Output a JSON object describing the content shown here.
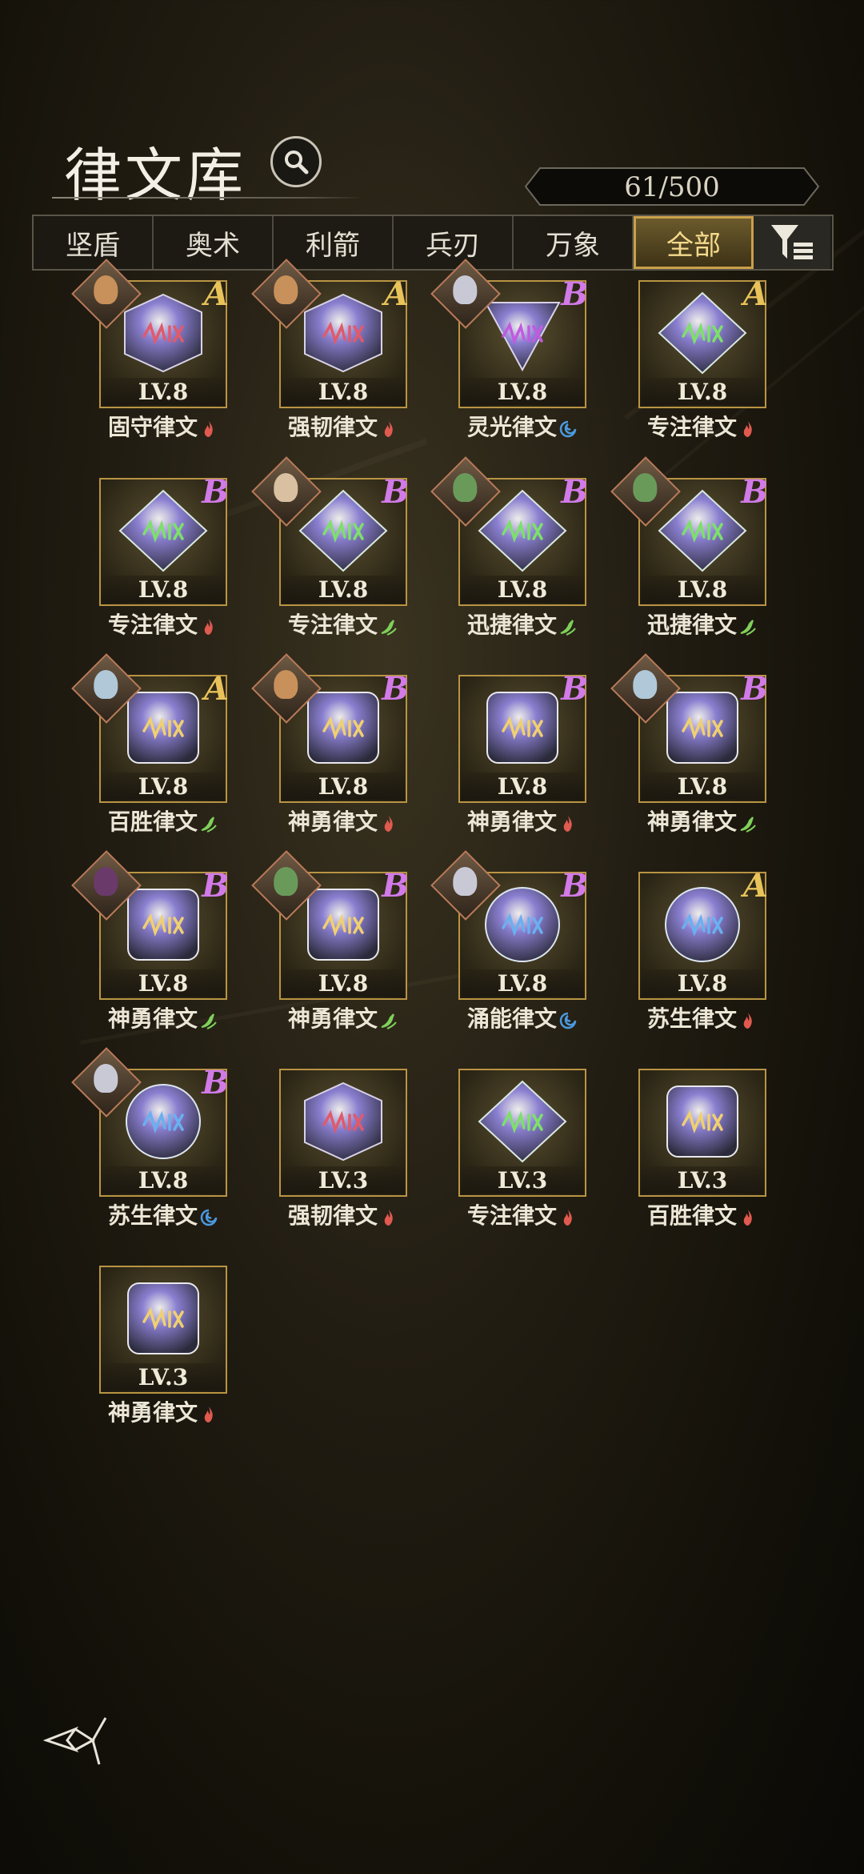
{
  "header": {
    "title": "律文库",
    "count": "61/500"
  },
  "tabs": [
    {
      "label": "坚盾",
      "active": false
    },
    {
      "label": "奥术",
      "active": false
    },
    {
      "label": "利箭",
      "active": false
    },
    {
      "label": "兵刃",
      "active": false
    },
    {
      "label": "万象",
      "active": false
    },
    {
      "label": "全部",
      "active": true
    }
  ],
  "colors": {
    "accent_gold": "#c9a04a",
    "grade_a": "#e8c35a",
    "grade_b": "#d17ae8",
    "fire": "#e05a50",
    "wind": "#7fd05a",
    "water": "#4a9ae0"
  },
  "runes": [
    {
      "name": "固守律文",
      "level": "LV.8",
      "grade": "A",
      "gem": "hex",
      "gem_color": "#8a7fd0",
      "rune_color": "#e05a6a",
      "element": "fire",
      "avatar": "#c8905a"
    },
    {
      "name": "强韧律文",
      "level": "LV.8",
      "grade": "A",
      "gem": "hex",
      "gem_color": "#8a7fd0",
      "rune_color": "#e05a6a",
      "element": "fire",
      "avatar": "#c8905a"
    },
    {
      "name": "灵光律文",
      "level": "LV.8",
      "grade": "B",
      "gem": "tri",
      "gem_color": "#9a8ad0",
      "rune_color": "#c25ae0",
      "element": "water",
      "avatar": "#c9c9d6"
    },
    {
      "name": "专注律文",
      "level": "LV.8",
      "grade": "A",
      "gem": "diamond",
      "gem_color": "#6fa08a",
      "rune_color": "#7de06a",
      "element": "fire",
      "avatar": null
    },
    {
      "name": "专注律文",
      "level": "LV.8",
      "grade": "B",
      "gem": "diamond",
      "gem_color": "#6fa08a",
      "rune_color": "#7de06a",
      "element": "fire",
      "avatar": null
    },
    {
      "name": "专注律文",
      "level": "LV.8",
      "grade": "B",
      "gem": "diamond",
      "gem_color": "#6fa08a",
      "rune_color": "#7de06a",
      "element": "wind",
      "avatar": "#d8c0a0"
    },
    {
      "name": "迅捷律文",
      "level": "LV.8",
      "grade": "B",
      "gem": "diamond",
      "gem_color": "#6fa08a",
      "rune_color": "#7de06a",
      "element": "wind",
      "avatar": "#6a9a5a"
    },
    {
      "name": "迅捷律文",
      "level": "LV.8",
      "grade": "B",
      "gem": "diamond",
      "gem_color": "#6fa08a",
      "rune_color": "#7de06a",
      "element": "wind",
      "avatar": "#6a9a5a"
    },
    {
      "name": "百胜律文",
      "level": "LV.8",
      "grade": "A",
      "gem": "square",
      "gem_color": "#a9b0b8",
      "rune_color": "#f0d070",
      "element": "wind",
      "avatar": "#b0c8d8"
    },
    {
      "name": "神勇律文",
      "level": "LV.8",
      "grade": "B",
      "gem": "square",
      "gem_color": "#a9b0b8",
      "rune_color": "#f0d070",
      "element": "fire",
      "avatar": "#c8905a"
    },
    {
      "name": "神勇律文",
      "level": "LV.8",
      "grade": "B",
      "gem": "square",
      "gem_color": "#a9b0b8",
      "rune_color": "#f0d070",
      "element": "fire",
      "avatar": null
    },
    {
      "name": "神勇律文",
      "level": "LV.8",
      "grade": "B",
      "gem": "square",
      "gem_color": "#a9b0b8",
      "rune_color": "#f0d070",
      "element": "wind",
      "avatar": "#b0c8d8"
    },
    {
      "name": "神勇律文",
      "level": "LV.8",
      "grade": "B",
      "gem": "square",
      "gem_color": "#a9b0b8",
      "rune_color": "#f0d070",
      "element": "wind",
      "avatar": "#6a3a6a"
    },
    {
      "name": "神勇律文",
      "level": "LV.8",
      "grade": "B",
      "gem": "square",
      "gem_color": "#a9b0b8",
      "rune_color": "#f0d070",
      "element": "wind",
      "avatar": "#6a9a5a"
    },
    {
      "name": "涌能律文",
      "level": "LV.8",
      "grade": "B",
      "gem": "circle",
      "gem_color": "#8aa0c0",
      "rune_color": "#6ab0f0",
      "element": "water",
      "avatar": "#c9c9d6"
    },
    {
      "name": "苏生律文",
      "level": "LV.8",
      "grade": "A",
      "gem": "circle",
      "gem_color": "#8aa0c0",
      "rune_color": "#6ab0f0",
      "element": "fire",
      "avatar": null
    },
    {
      "name": "苏生律文",
      "level": "LV.8",
      "grade": "B",
      "gem": "circle",
      "gem_color": "#8aa0c0",
      "rune_color": "#6ab0f0",
      "element": "water",
      "avatar": "#c9c9d6"
    },
    {
      "name": "强韧律文",
      "level": "LV.3",
      "grade": "",
      "gem": "hex",
      "gem_color": "#8a7fd0",
      "rune_color": "#e05a6a",
      "element": "fire",
      "avatar": null
    },
    {
      "name": "专注律文",
      "level": "LV.3",
      "grade": "",
      "gem": "diamond",
      "gem_color": "#6fa08a",
      "rune_color": "#7de06a",
      "element": "fire",
      "avatar": null
    },
    {
      "name": "百胜律文",
      "level": "LV.3",
      "grade": "",
      "gem": "square",
      "gem_color": "#a9b0b8",
      "rune_color": "#f0d070",
      "element": "fire",
      "avatar": null
    },
    {
      "name": "神勇律文",
      "level": "LV.3",
      "grade": "",
      "gem": "square",
      "gem_color": "#a9b0b8",
      "rune_color": "#f0d070",
      "element": "fire",
      "avatar": null
    }
  ]
}
